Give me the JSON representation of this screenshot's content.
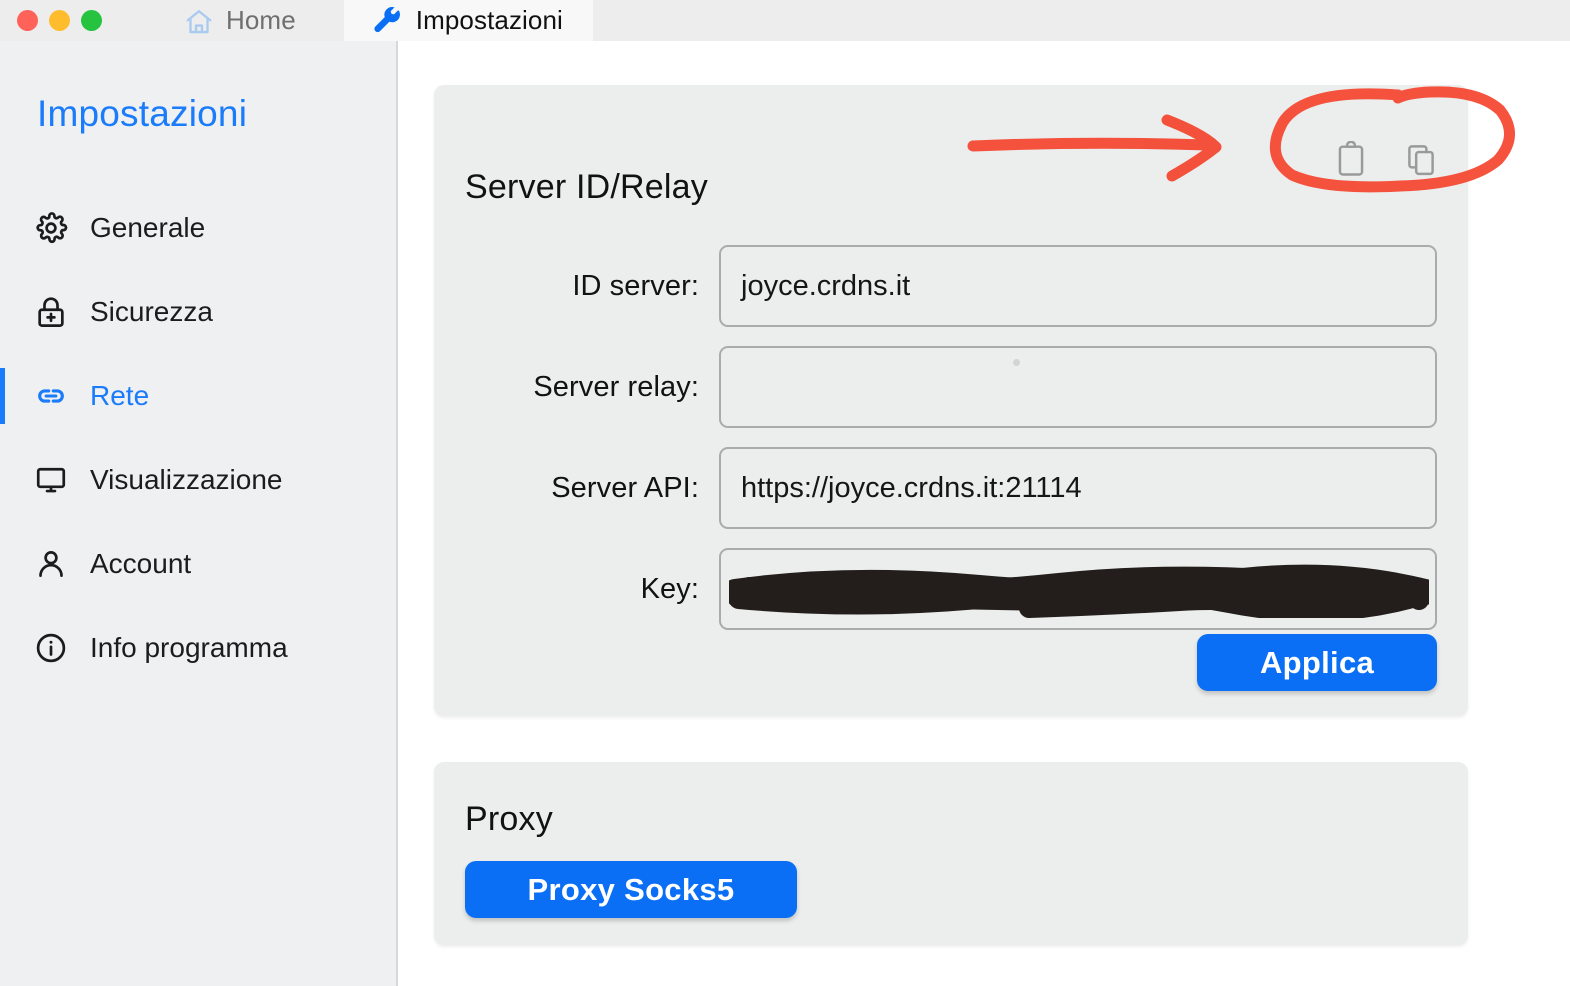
{
  "window": {
    "traffic_lights": [
      {
        "name": "close",
        "color": "#ff6259"
      },
      {
        "name": "minimize",
        "color": "#ffbd2e"
      },
      {
        "name": "maximize",
        "color": "#25c33f"
      }
    ],
    "tabs": [
      {
        "label": "Home",
        "icon": "home-icon",
        "active": false
      },
      {
        "label": "Impostazioni",
        "icon": "wrench-icon",
        "active": true
      }
    ]
  },
  "sidebar": {
    "title": "Impostazioni",
    "items": [
      {
        "label": "Generale",
        "icon": "gear-icon",
        "selected": false
      },
      {
        "label": "Sicurezza",
        "icon": "lock-icon",
        "selected": false
      },
      {
        "label": "Rete",
        "icon": "link-icon",
        "selected": true
      },
      {
        "label": "Visualizzazione",
        "icon": "monitor-icon",
        "selected": false
      },
      {
        "label": "Account",
        "icon": "person-icon",
        "selected": false
      },
      {
        "label": "Info programma",
        "icon": "info-icon",
        "selected": false
      }
    ]
  },
  "main": {
    "server_card": {
      "title": "Server ID/Relay",
      "actions": [
        {
          "name": "paste-clipboard-icon",
          "label": "clipboard-icon"
        },
        {
          "name": "copy-icon",
          "label": "copy-icon"
        }
      ],
      "fields": [
        {
          "label": "ID server:",
          "value": "joyce.crdns.it",
          "placeholder": "",
          "redacted": false
        },
        {
          "label": "Server relay:",
          "value": "",
          "placeholder": "",
          "redacted": false
        },
        {
          "label": "Server API:",
          "value": "https://joyce.crdns.it:21114",
          "placeholder": "",
          "redacted": false
        },
        {
          "label": "Key:",
          "value": "",
          "placeholder": "",
          "redacted": true
        }
      ],
      "apply_label": "Applica"
    },
    "proxy_card": {
      "title": "Proxy",
      "button_label": "Proxy Socks5"
    }
  },
  "annotation": {
    "color": "#f4462e",
    "shapes": [
      "arrow-pointing-right",
      "ellipse-circling-icons"
    ]
  },
  "colors": {
    "accent_blue": "#1a7bfb",
    "button_blue": "#0a6ff5",
    "annotation_red": "#f4462e",
    "sidebar_bg": "#eff0f1",
    "card_bg": "#eceded",
    "titlebar_bg": "#ededed"
  }
}
